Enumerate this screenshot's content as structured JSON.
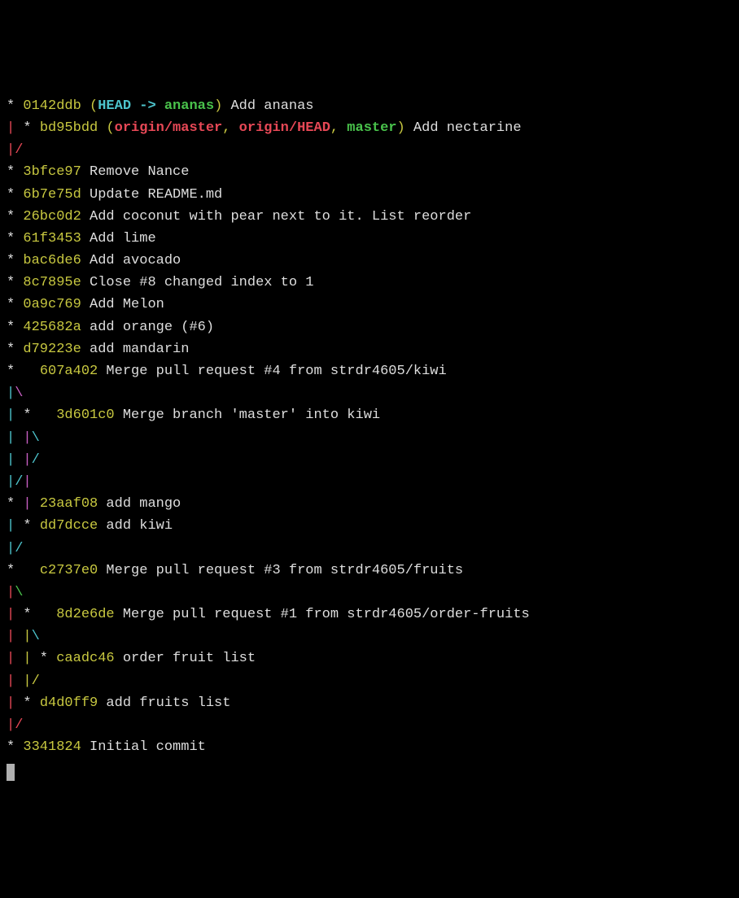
{
  "lines": [
    [
      {
        "cls": "white",
        "text": "* "
      },
      {
        "cls": "yellow",
        "text": "0142ddb "
      },
      {
        "cls": "yellow",
        "text": "("
      },
      {
        "cls": "cyan bold",
        "text": "HEAD -> "
      },
      {
        "cls": "green bold",
        "text": "ananas"
      },
      {
        "cls": "yellow",
        "text": ")"
      },
      {
        "cls": "white",
        "text": " Add ananas"
      }
    ],
    [
      {
        "cls": "red",
        "text": "|"
      },
      {
        "cls": "white",
        "text": " * "
      },
      {
        "cls": "yellow",
        "text": "bd95bdd "
      },
      {
        "cls": "yellow",
        "text": "("
      },
      {
        "cls": "red bold",
        "text": "origin/master"
      },
      {
        "cls": "yellow",
        "text": ", "
      },
      {
        "cls": "red bold",
        "text": "origin/HEAD"
      },
      {
        "cls": "yellow",
        "text": ", "
      },
      {
        "cls": "green bold",
        "text": "master"
      },
      {
        "cls": "yellow",
        "text": ")"
      },
      {
        "cls": "white",
        "text": " Add nectarine"
      }
    ],
    [
      {
        "cls": "red",
        "text": "|"
      },
      {
        "cls": "red",
        "text": "/"
      }
    ],
    [
      {
        "cls": "white",
        "text": "* "
      },
      {
        "cls": "yellow",
        "text": "3bfce97"
      },
      {
        "cls": "white",
        "text": " Remove Nance"
      }
    ],
    [
      {
        "cls": "white",
        "text": "* "
      },
      {
        "cls": "yellow",
        "text": "6b7e75d"
      },
      {
        "cls": "white",
        "text": " Update README.md"
      }
    ],
    [
      {
        "cls": "white",
        "text": "* "
      },
      {
        "cls": "yellow",
        "text": "26bc0d2"
      },
      {
        "cls": "white",
        "text": " Add coconut with pear next to it. List reorder"
      }
    ],
    [
      {
        "cls": "white",
        "text": "* "
      },
      {
        "cls": "yellow",
        "text": "61f3453"
      },
      {
        "cls": "white",
        "text": " Add lime"
      }
    ],
    [
      {
        "cls": "white",
        "text": "* "
      },
      {
        "cls": "yellow",
        "text": "bac6de6"
      },
      {
        "cls": "white",
        "text": " Add avocado"
      }
    ],
    [
      {
        "cls": "white",
        "text": "* "
      },
      {
        "cls": "yellow",
        "text": "8c7895e"
      },
      {
        "cls": "white",
        "text": " Close #8 changed index to 1"
      }
    ],
    [
      {
        "cls": "white",
        "text": "* "
      },
      {
        "cls": "yellow",
        "text": "0a9c769"
      },
      {
        "cls": "white",
        "text": " Add Melon"
      }
    ],
    [
      {
        "cls": "white",
        "text": "* "
      },
      {
        "cls": "yellow",
        "text": "425682a"
      },
      {
        "cls": "white",
        "text": " add orange (#6)"
      }
    ],
    [
      {
        "cls": "white",
        "text": "* "
      },
      {
        "cls": "yellow",
        "text": "d79223e"
      },
      {
        "cls": "white",
        "text": " add mandarin"
      }
    ],
    [
      {
        "cls": "white",
        "text": "*   "
      },
      {
        "cls": "yellow",
        "text": "607a402"
      },
      {
        "cls": "white",
        "text": " Merge pull request #4 from strdr4605/kiwi"
      }
    ],
    [
      {
        "cls": "cyan",
        "text": "|"
      },
      {
        "cls": "magenta",
        "text": "\\"
      }
    ],
    [
      {
        "cls": "cyan",
        "text": "|"
      },
      {
        "cls": "white",
        "text": " *   "
      },
      {
        "cls": "yellow",
        "text": "3d601c0"
      },
      {
        "cls": "white",
        "text": " Merge branch 'master' into kiwi"
      }
    ],
    [
      {
        "cls": "cyan",
        "text": "|"
      },
      {
        "cls": "white",
        "text": " "
      },
      {
        "cls": "magenta",
        "text": "|"
      },
      {
        "cls": "cyan",
        "text": "\\"
      }
    ],
    [
      {
        "cls": "cyan",
        "text": "|"
      },
      {
        "cls": "white",
        "text": " "
      },
      {
        "cls": "magenta",
        "text": "|"
      },
      {
        "cls": "cyan",
        "text": "/"
      }
    ],
    [
      {
        "cls": "cyan",
        "text": "|"
      },
      {
        "cls": "cyan",
        "text": "/"
      },
      {
        "cls": "magenta",
        "text": "|"
      }
    ],
    [
      {
        "cls": "white",
        "text": "* "
      },
      {
        "cls": "magenta",
        "text": "|"
      },
      {
        "cls": "white",
        "text": " "
      },
      {
        "cls": "yellow",
        "text": "23aaf08"
      },
      {
        "cls": "white",
        "text": " add mango"
      }
    ],
    [
      {
        "cls": "cyan",
        "text": "|"
      },
      {
        "cls": "white",
        "text": " * "
      },
      {
        "cls": "yellow",
        "text": "dd7dcce"
      },
      {
        "cls": "white",
        "text": " add kiwi"
      }
    ],
    [
      {
        "cls": "cyan",
        "text": "|"
      },
      {
        "cls": "cyan",
        "text": "/"
      }
    ],
    [
      {
        "cls": "white",
        "text": "*   "
      },
      {
        "cls": "yellow",
        "text": "c2737e0"
      },
      {
        "cls": "white",
        "text": " Merge pull request #3 from strdr4605/fruits"
      }
    ],
    [
      {
        "cls": "red",
        "text": "|"
      },
      {
        "cls": "green",
        "text": "\\"
      }
    ],
    [
      {
        "cls": "red",
        "text": "|"
      },
      {
        "cls": "white",
        "text": " *   "
      },
      {
        "cls": "yellow",
        "text": "8d2e6de"
      },
      {
        "cls": "white",
        "text": " Merge pull request #1 from strdr4605/order-fruits"
      }
    ],
    [
      {
        "cls": "red",
        "text": "|"
      },
      {
        "cls": "white",
        "text": " "
      },
      {
        "cls": "yellow",
        "text": "|"
      },
      {
        "cls": "cyan",
        "text": "\\"
      }
    ],
    [
      {
        "cls": "red",
        "text": "|"
      },
      {
        "cls": "white",
        "text": " "
      },
      {
        "cls": "yellow",
        "text": "|"
      },
      {
        "cls": "white",
        "text": " * "
      },
      {
        "cls": "yellow",
        "text": "caadc46"
      },
      {
        "cls": "white",
        "text": " order fruit list"
      }
    ],
    [
      {
        "cls": "red",
        "text": "|"
      },
      {
        "cls": "white",
        "text": " "
      },
      {
        "cls": "yellow",
        "text": "|"
      },
      {
        "cls": "yellow",
        "text": "/"
      }
    ],
    [
      {
        "cls": "red",
        "text": "|"
      },
      {
        "cls": "white",
        "text": " * "
      },
      {
        "cls": "yellow",
        "text": "d4d0ff9"
      },
      {
        "cls": "white",
        "text": " add fruits list"
      }
    ],
    [
      {
        "cls": "red",
        "text": "|"
      },
      {
        "cls": "red",
        "text": "/"
      }
    ],
    [
      {
        "cls": "white",
        "text": "* "
      },
      {
        "cls": "yellow",
        "text": "3341824"
      },
      {
        "cls": "white",
        "text": " Initial commit"
      }
    ]
  ]
}
